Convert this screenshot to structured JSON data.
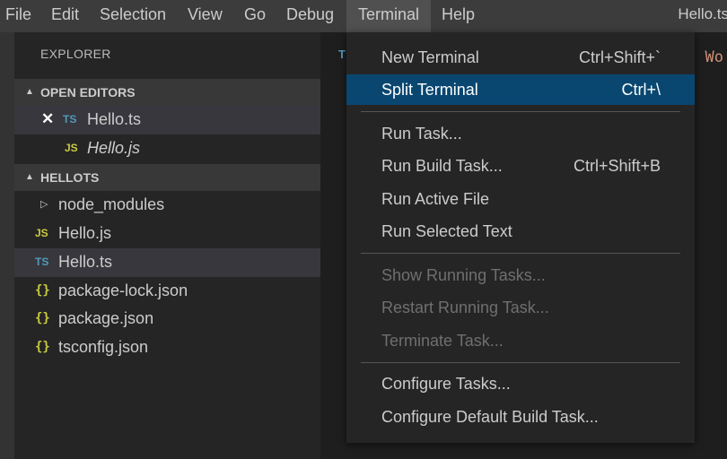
{
  "menubar": {
    "items": [
      "File",
      "Edit",
      "Selection",
      "View",
      "Go",
      "Debug",
      "Terminal",
      "Help"
    ],
    "active": "Terminal",
    "window_title": "Hello.ts"
  },
  "sidebar": {
    "title": "EXPLORER",
    "open_editors": {
      "label": "OPEN EDITORS",
      "items": [
        {
          "badge": "TS",
          "name": "Hello.ts",
          "close": "✕"
        },
        {
          "badge": "JS",
          "name": "Hello.js"
        }
      ]
    },
    "project": {
      "label": "HELLOTS",
      "items": [
        {
          "badge": "",
          "name": "node_modules"
        },
        {
          "badge": "JS",
          "name": "Hello.js"
        },
        {
          "badge": "TS",
          "name": "Hello.ts"
        },
        {
          "badge": "{}",
          "name": "package-lock.json"
        },
        {
          "badge": "{}",
          "name": "package.json"
        },
        {
          "badge": "{}",
          "name": "tsconfig.json"
        }
      ]
    }
  },
  "editor": {
    "tab_badge": "T",
    "code_fragment": "o Wo"
  },
  "terminal_menu": {
    "items": [
      {
        "label": "New Terminal",
        "shortcut": "Ctrl+Shift+`"
      },
      {
        "label": "Split Terminal",
        "shortcut": "Ctrl+\\"
      },
      {
        "label": "Run Task...",
        "shortcut": ""
      },
      {
        "label": "Run Build Task...",
        "shortcut": "Ctrl+Shift+B"
      },
      {
        "label": "Run Active File",
        "shortcut": ""
      },
      {
        "label": "Run Selected Text",
        "shortcut": ""
      },
      {
        "label": "Show Running Tasks...",
        "shortcut": ""
      },
      {
        "label": "Restart Running Task...",
        "shortcut": ""
      },
      {
        "label": "Terminate Task...",
        "shortcut": ""
      },
      {
        "label": "Configure Tasks...",
        "shortcut": ""
      },
      {
        "label": "Configure Default Build Task...",
        "shortcut": ""
      }
    ],
    "highlighted": "Split Terminal"
  },
  "colors": {
    "menubar_bg": "#3c3c3c",
    "sidebar_bg": "#252526",
    "highlight": "#094771",
    "ts_badge": "#519aba",
    "js_badge": "#cbcb41"
  }
}
